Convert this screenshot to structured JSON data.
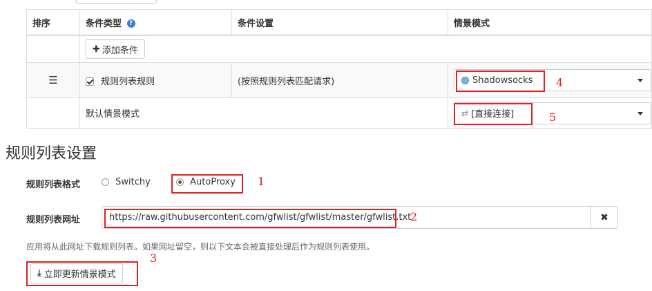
{
  "table": {
    "headers": {
      "order": "排序",
      "condition_type": "条件类型",
      "condition_settings": "条件设置",
      "profile": "情景模式"
    },
    "add_condition_label": "添加条件",
    "rule_row": {
      "checked": true,
      "type_label": "规则列表规则",
      "settings_text": "(按照规则列表匹配请求)",
      "profile_value": "Shadowsocks"
    },
    "default_row": {
      "label": "默认情景模式",
      "profile_value": "[直接连接]"
    }
  },
  "section_title": "规则列表设置",
  "format": {
    "label": "规则列表格式",
    "options": [
      "Switchy",
      "AutoProxy"
    ],
    "selected": "AutoProxy"
  },
  "url": {
    "label": "规则列表网址",
    "value": "https://raw.githubusercontent.com/gfwlist/gfwlist/master/gfwlist.txt"
  },
  "help_text": "应用将从此网址下载规则列表。如果网址留空，则以下文本会被直接处理后作为规则列表使用。",
  "update_button_label": "立即更新情景模式",
  "annotations": [
    "1",
    "2",
    "3",
    "4",
    "5"
  ],
  "colors": {
    "annotation_red": "#e02020",
    "help_icon_blue": "#3a7bd5"
  }
}
